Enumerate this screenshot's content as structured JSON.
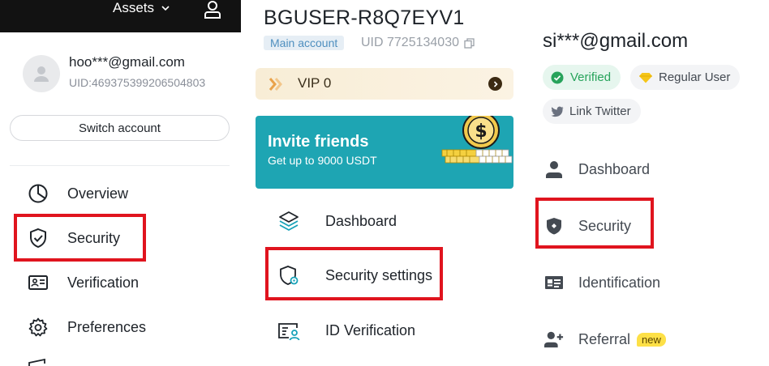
{
  "panel1": {
    "topbar": {
      "assets_label": "Assets"
    },
    "account": {
      "email": "hoo***@gmail.com",
      "uid": "UID:469375399206504803"
    },
    "switch_account_label": "Switch account",
    "nav": [
      {
        "label": "Overview",
        "icon": "pie-chart-icon"
      },
      {
        "label": "Security",
        "icon": "shield-check-icon"
      },
      {
        "label": "Verification",
        "icon": "id-card-icon"
      },
      {
        "label": "Preferences",
        "icon": "gear-icon"
      }
    ],
    "highlight_color": "#e0141e"
  },
  "panel2": {
    "username": "BGUSER-R8Q7EYV1",
    "account_badge": "Main account",
    "uid": "UID 7725134030",
    "vip_label": "VIP 0",
    "invite": {
      "title": "Invite friends",
      "subtitle": "Get up to 9000 USDT",
      "bg_color": "#1ea5b3"
    },
    "nav": [
      {
        "label": "Dashboard",
        "icon": "layers-icon"
      },
      {
        "label": "Security settings",
        "icon": "shield-gear-icon"
      },
      {
        "label": "ID Verification",
        "icon": "id-person-icon"
      }
    ]
  },
  "panel3": {
    "email": "si***@gmail.com",
    "badges": {
      "verified": "Verified",
      "regular": "Regular User",
      "twitter": "Link Twitter"
    },
    "nav": [
      {
        "label": "Dashboard",
        "icon": "person-icon"
      },
      {
        "label": "Security",
        "icon": "shield-icon"
      },
      {
        "label": "Identification",
        "icon": "id-card-icon"
      },
      {
        "label": "Referral",
        "icon": "add-user-icon",
        "badge": "new"
      }
    ]
  }
}
